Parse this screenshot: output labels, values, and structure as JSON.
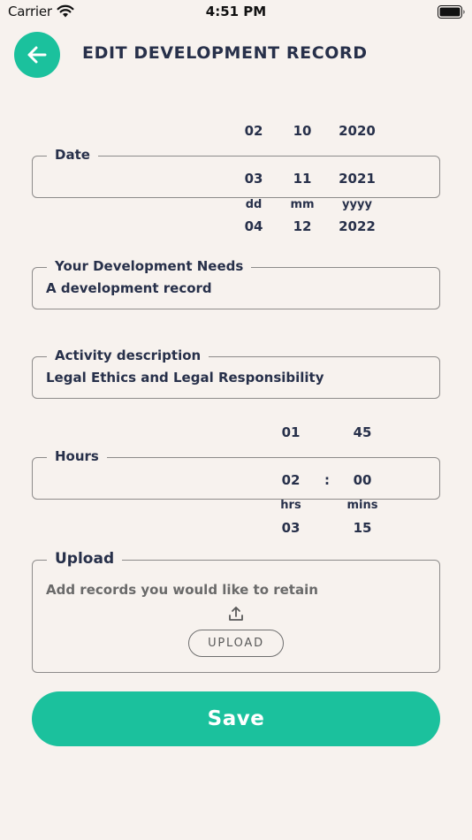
{
  "status_bar": {
    "carrier": "Carrier",
    "time": "4:51 PM"
  },
  "header": {
    "title": "EDIT DEVELOPMENT RECORD",
    "back_icon": "arrow-left-icon"
  },
  "date": {
    "label": "Date",
    "above": {
      "day": "02",
      "month": "10",
      "year": "2020"
    },
    "selected": {
      "day": "03",
      "month": "11",
      "year": "2021"
    },
    "units": {
      "day": "dd",
      "month": "mm",
      "year": "yyyy"
    },
    "below": {
      "day": "04",
      "month": "12",
      "year": "2022"
    }
  },
  "development_needs": {
    "label": "Your Development Needs",
    "value": "A development record"
  },
  "activity": {
    "label": "Activity description",
    "value": "Legal Ethics and Legal Responsibility"
  },
  "hours": {
    "label": "Hours",
    "above": {
      "hrs": "01",
      "mins": "45"
    },
    "selected": {
      "hrs": "02",
      "separator": ":",
      "mins": "00"
    },
    "units": {
      "hrs": "hrs",
      "mins": "mins"
    },
    "below": {
      "hrs": "03",
      "mins": "15"
    }
  },
  "upload": {
    "label": "Upload",
    "hint": "Add records you would like to retain",
    "icon": "upload-icon",
    "button_label": "UPLOAD"
  },
  "save": {
    "label": "Save"
  },
  "colors": {
    "accent": "#1bc19d",
    "text": "#27304a",
    "background": "#f7f2ee"
  }
}
